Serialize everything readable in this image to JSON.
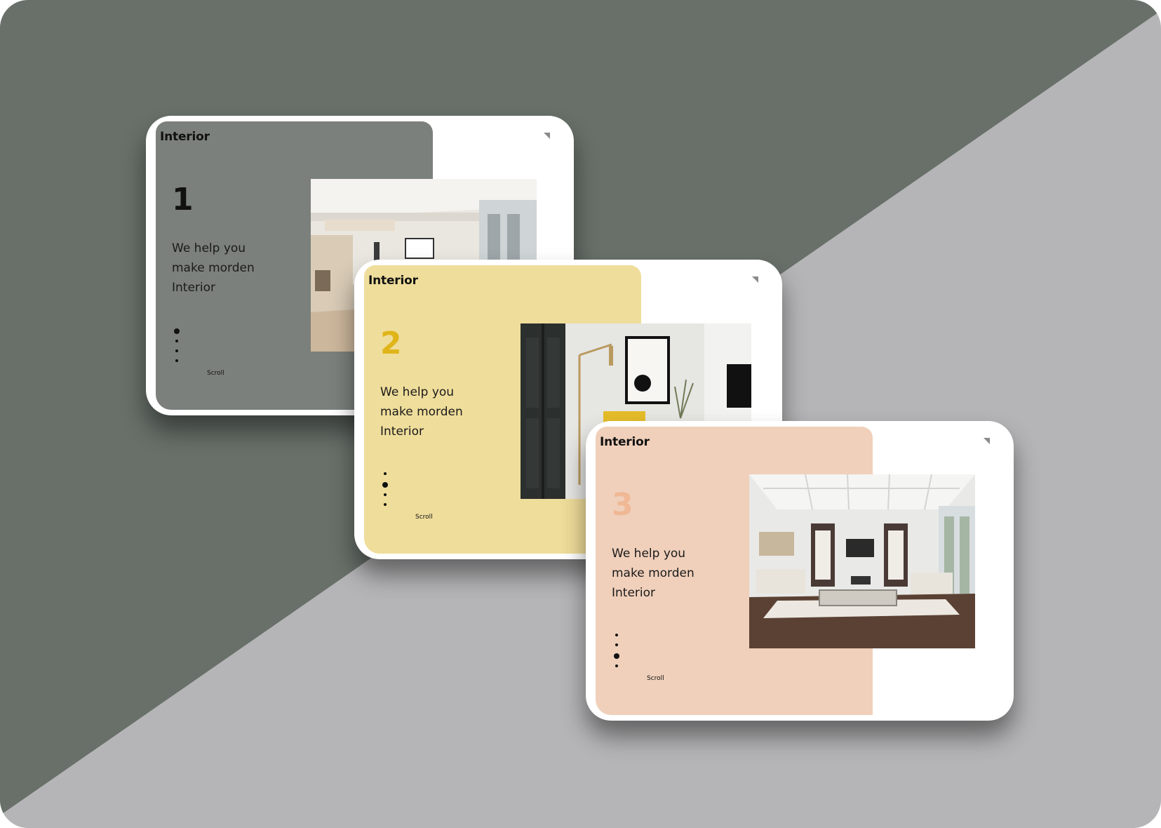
{
  "colors": {
    "background_dark": "#687069",
    "background_light": "#b5b5b7"
  },
  "cards": [
    {
      "brand": "Interior",
      "number": "1",
      "tagline": "We help you\nmake morden\nInterior",
      "scroll_label": "Scroll",
      "active_dot": 0,
      "panel_color": "#7b807c",
      "number_color": "#111111",
      "photo": "bright-kitchen-interior"
    },
    {
      "brand": "Interior",
      "number": "2",
      "tagline": "We help you\nmake morden\nInterior",
      "scroll_label": "Scroll",
      "active_dot": 1,
      "panel_color": "#efdd9b",
      "number_color": "#e0b51a",
      "photo": "wall-art-with-floor-lamp"
    },
    {
      "brand": "Interior",
      "number": "3",
      "tagline": "We help you\nmake morden\nInterior",
      "scroll_label": "Scroll",
      "active_dot": 2,
      "panel_color": "#f0d0bb",
      "number_color": "#f0b894",
      "photo": "coffered-living-room"
    }
  ],
  "icons": {
    "corner": "corner-arrow-icon"
  }
}
